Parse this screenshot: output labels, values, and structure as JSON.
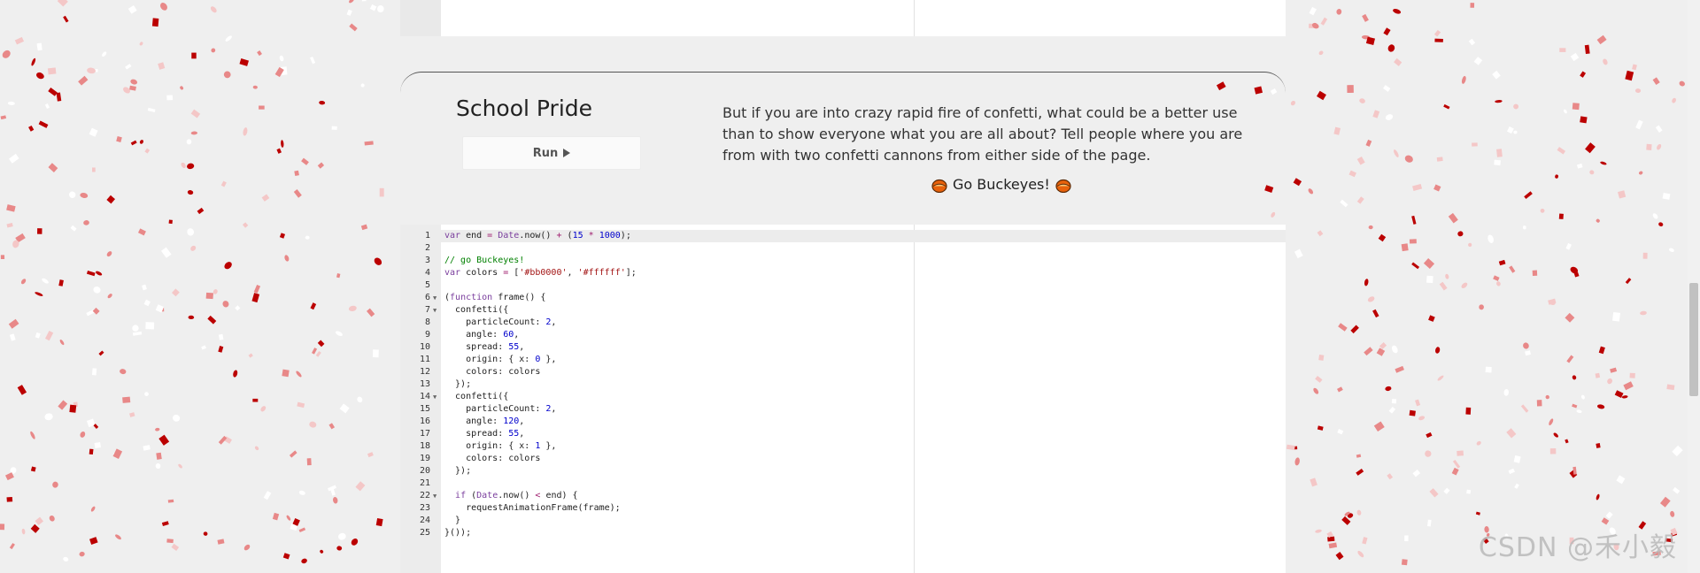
{
  "demo": {
    "title": "School Pride",
    "run_label": "Run",
    "description": "But if you are into crazy rapid fire of confetti, what could be a better use than to show everyone what you are all about? Tell people where you are from with two confetti cannons from either side of the page.",
    "tagline": "Go Buckeyes!",
    "tagline_icon": "buckeye-icon"
  },
  "editor": {
    "lines": [
      {
        "n": "1",
        "fold": false,
        "text": "var end = Date.now() + (15 * 1000);"
      },
      {
        "n": "2",
        "fold": false,
        "text": ""
      },
      {
        "n": "3",
        "fold": false,
        "text": "// go Buckeyes!"
      },
      {
        "n": "4",
        "fold": false,
        "text": "var colors = ['#bb0000', '#ffffff'];"
      },
      {
        "n": "5",
        "fold": false,
        "text": ""
      },
      {
        "n": "6",
        "fold": true,
        "text": "(function frame() {"
      },
      {
        "n": "7",
        "fold": true,
        "text": "  confetti({"
      },
      {
        "n": "8",
        "fold": false,
        "text": "    particleCount: 2,"
      },
      {
        "n": "9",
        "fold": false,
        "text": "    angle: 60,"
      },
      {
        "n": "10",
        "fold": false,
        "text": "    spread: 55,"
      },
      {
        "n": "11",
        "fold": false,
        "text": "    origin: { x: 0 },"
      },
      {
        "n": "12",
        "fold": false,
        "text": "    colors: colors"
      },
      {
        "n": "13",
        "fold": false,
        "text": "  });"
      },
      {
        "n": "14",
        "fold": true,
        "text": "  confetti({"
      },
      {
        "n": "15",
        "fold": false,
        "text": "    particleCount: 2,"
      },
      {
        "n": "16",
        "fold": false,
        "text": "    angle: 120,"
      },
      {
        "n": "17",
        "fold": false,
        "text": "    spread: 55,"
      },
      {
        "n": "18",
        "fold": false,
        "text": "    origin: { x: 1 },"
      },
      {
        "n": "19",
        "fold": false,
        "text": "    colors: colors"
      },
      {
        "n": "20",
        "fold": false,
        "text": "  });"
      },
      {
        "n": "21",
        "fold": false,
        "text": ""
      },
      {
        "n": "22",
        "fold": true,
        "text": "  if (Date.now() < end) {"
      },
      {
        "n": "23",
        "fold": false,
        "text": "    requestAnimationFrame(frame);"
      },
      {
        "n": "24",
        "fold": false,
        "text": "  }"
      },
      {
        "n": "25",
        "fold": false,
        "text": "}());"
      }
    ],
    "active_line": "1"
  },
  "confetti_colors": [
    "#bb0000",
    "#ffffff",
    "#e88888",
    "#f4c7c7"
  ],
  "watermark": "CSDN @禾小毅"
}
